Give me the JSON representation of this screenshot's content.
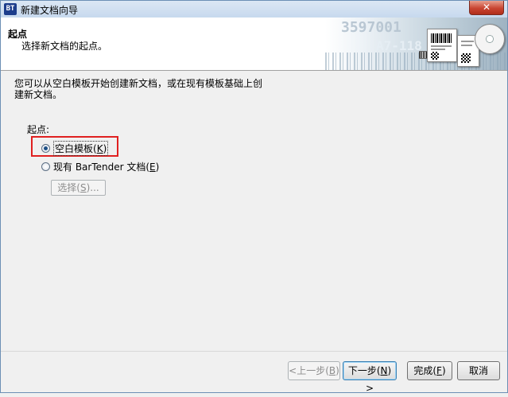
{
  "window": {
    "title": "新建文档向导",
    "app_icon_text": "BT",
    "close_glyph": "✕"
  },
  "header": {
    "title": "起点",
    "subtitle": "选择新文档的起点。",
    "banner_numbers": [
      "3597001",
      "A7-118"
    ]
  },
  "intro": {
    "line1": "您可以从空白模板开始创建新文档，或在现有模板基础上创",
    "line2": "建新文档。"
  },
  "start_point": {
    "label": "起点:",
    "options": [
      {
        "label": "空白模板(",
        "mnemonic": "K",
        "suffix": ")",
        "checked": true
      },
      {
        "label": "现有 BarTender 文档(",
        "mnemonic": "E",
        "suffix": ")",
        "checked": false
      }
    ],
    "browse_button": {
      "label": "选择(",
      "mnemonic": "S",
      "suffix": ")...",
      "enabled": false
    }
  },
  "footer": {
    "back": {
      "label": "<上一步(",
      "mnemonic": "B",
      "suffix": ")",
      "enabled": false
    },
    "next": {
      "label": "下一步(",
      "mnemonic": "N",
      "suffix": ") >"
    },
    "finish": {
      "label": "完成(",
      "mnemonic": "F",
      "suffix": ")"
    },
    "cancel": {
      "label": "取消"
    }
  },
  "colors": {
    "highlight_box": "#e02020",
    "window_bg": "#f0f0f0",
    "close_button": "#c94532"
  }
}
